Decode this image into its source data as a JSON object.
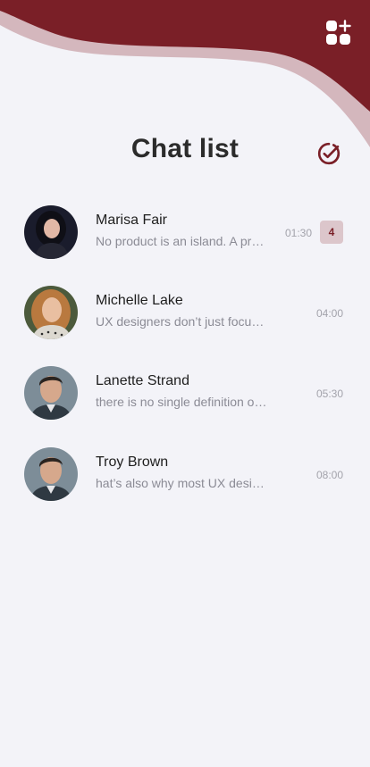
{
  "theme": {
    "accent": "#7a1f27",
    "accent_light": "#d4b7bd",
    "background": "#f3f3f8"
  },
  "header": {
    "title": "Chat list",
    "apps_icon": "apps-plus-icon",
    "check_icon": "check-circle-icon"
  },
  "chats": [
    {
      "name": "Marisa Fair",
      "preview": "No product is an island. A product is more than the product.",
      "time": "01:30",
      "unread": "4",
      "avatar": "avatar-photo"
    },
    {
      "name": "Michelle Lake",
      "preview": "UX designers don’t just focus on creating products that are usable",
      "time": "04:00",
      "avatar": "avatar-photo"
    },
    {
      "name": "Lanette Strand",
      "preview": "there is no single definition of a good user experience",
      "time": "05:30",
      "avatar": "avatar-photo"
    },
    {
      "name": "Troy Brown",
      "preview": "hat’s also why most UX designers work closely with product teams",
      "time": "08:00",
      "avatar": "avatar-photo"
    }
  ]
}
